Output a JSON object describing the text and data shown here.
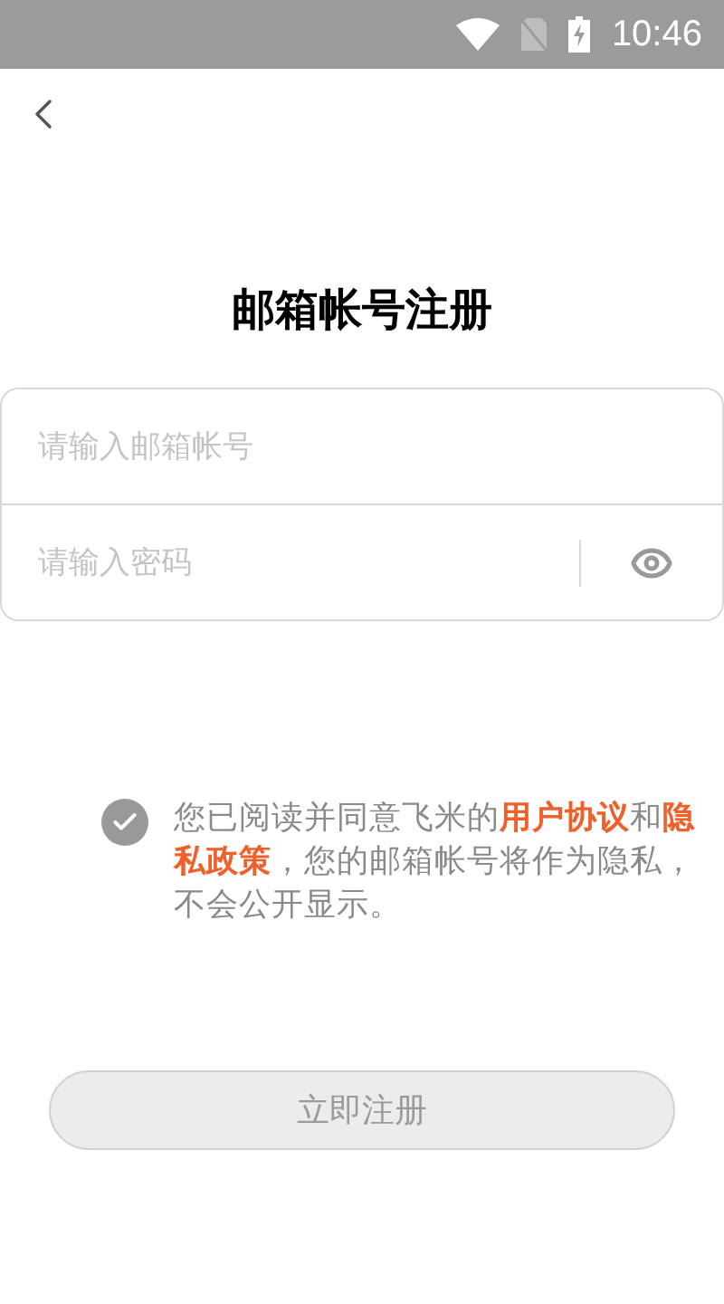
{
  "status_bar": {
    "time": "10:46"
  },
  "title": "邮箱帐号注册",
  "email_field": {
    "placeholder": "请输入邮箱帐号"
  },
  "password_field": {
    "placeholder": "请输入密码"
  },
  "agreement": {
    "checked": true,
    "text": "您已阅读并同意飞米的**用户协议**和**隐私政策**，您的邮箱帐号将作为隐私，不会公开显示。"
  },
  "submit_button": {
    "label": "立即注册"
  }
}
